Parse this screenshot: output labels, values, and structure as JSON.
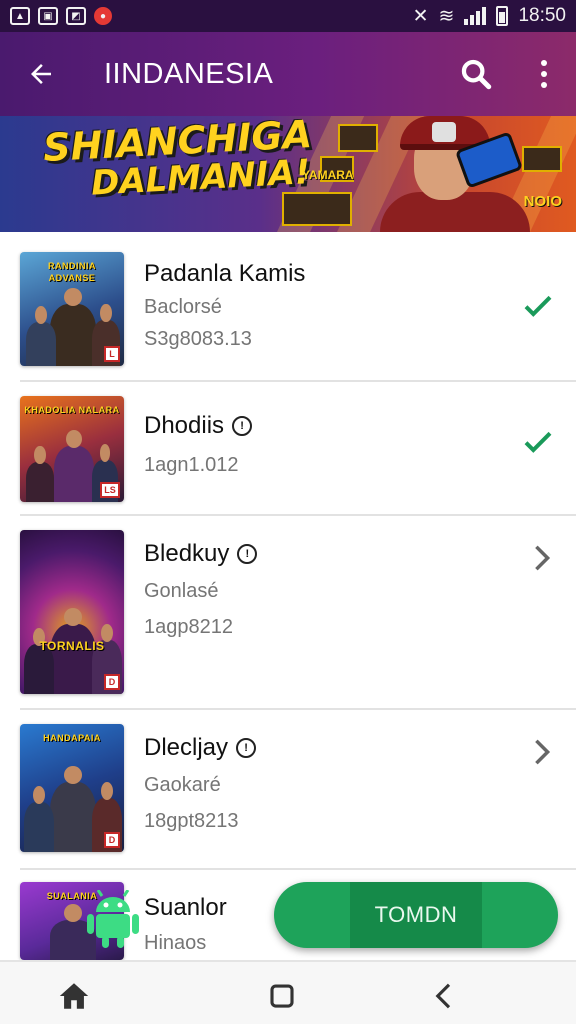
{
  "status_bar": {
    "time": "18:50",
    "icons": [
      "gallery-icon",
      "image-icon",
      "photo-icon",
      "record-icon",
      "mute-icon",
      "wifi-icon",
      "signal-icon",
      "battery-icon"
    ]
  },
  "app_bar": {
    "title": "IINDANESIA",
    "back_icon": "arrow-left-icon",
    "search_icon": "search-icon",
    "more_icon": "more-vert-icon"
  },
  "banner": {
    "title_line1": "SHIANCHIGA",
    "title_line2": "DALMANIA!",
    "small_tag": "YAMARA",
    "corner_tag": "NOIO"
  },
  "items": [
    {
      "title": "Padanla Kamis",
      "subtitle": "Baclorsé",
      "meta": "S3g8083.13",
      "thumb_text": "RANDINIA ADVANSE",
      "has_info": false,
      "status": "check",
      "badge": "L"
    },
    {
      "title": "Dhodiis",
      "subtitle": "",
      "meta": "1agn1.012",
      "thumb_text": "KHADOLIA NALARA",
      "has_info": true,
      "status": "check",
      "badge": "LS"
    },
    {
      "title": "Bledkuy",
      "subtitle": "Gonlasé",
      "meta": "1agp8212",
      "thumb_text": "TORNALIS",
      "has_info": true,
      "status": "chevron",
      "badge": "D"
    },
    {
      "title": "Dlecljay",
      "subtitle": "Gaokaré",
      "meta": "18gpt8213",
      "thumb_text": "HANDAPAIA",
      "has_info": true,
      "status": "chevron",
      "badge": "D"
    },
    {
      "title": "Suanlor",
      "subtitle": "Hinaos",
      "meta": "",
      "thumb_text": "SUALANIA",
      "has_info": false,
      "status": "none",
      "badge": ""
    }
  ],
  "fab": {
    "label": "TOMDN"
  },
  "nav_bar": {
    "home_icon": "home-icon",
    "recents_icon": "square-icon",
    "back_icon": "back-chevron-icon"
  },
  "colors": {
    "appbar_start": "#4a1a6e",
    "appbar_end": "#8c2a6a",
    "check_green": "#1a9a5a",
    "fab_green": "#1ea35a",
    "banner_text": "#ffd21f"
  }
}
